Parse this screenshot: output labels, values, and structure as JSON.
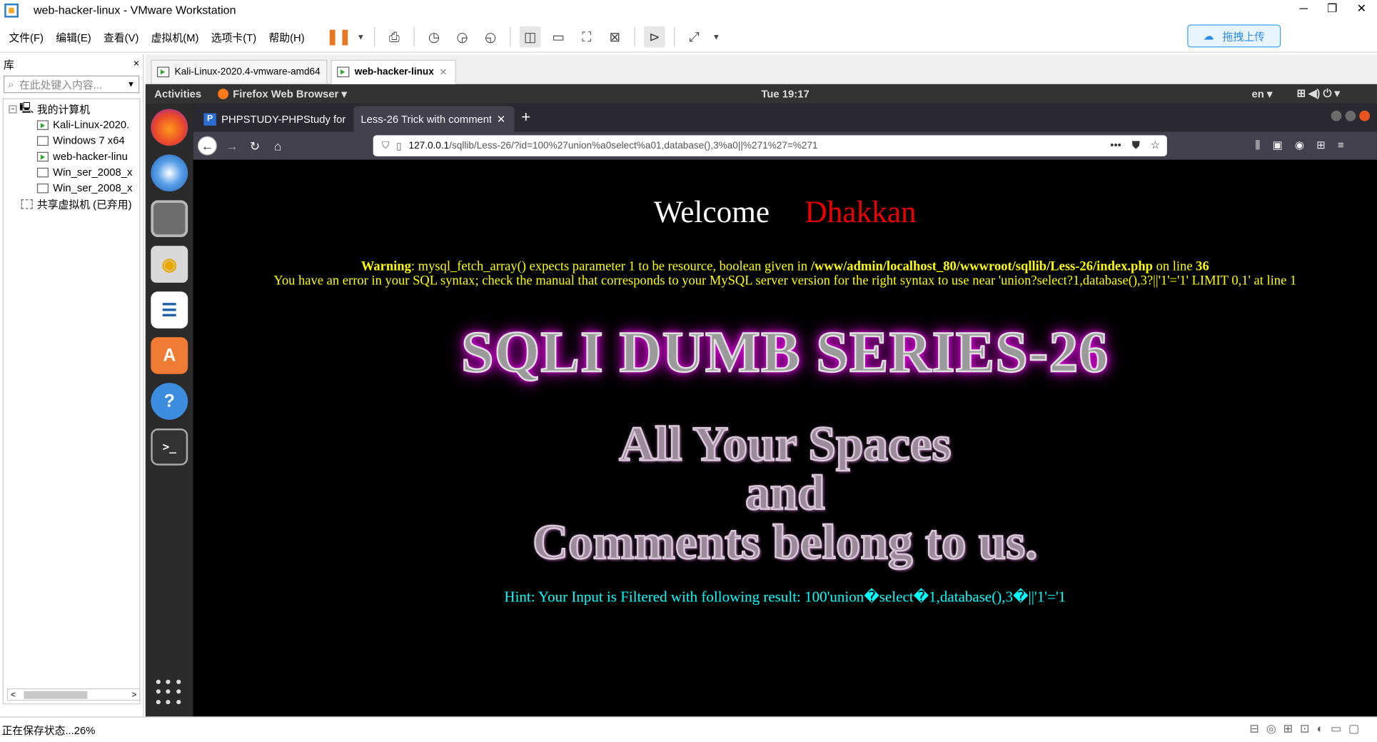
{
  "window": {
    "title": "web-hacker-linux - VMware Workstation",
    "controls": [
      "─",
      "❐",
      "✕"
    ]
  },
  "menubar": {
    "items": [
      "文件(F)",
      "编辑(E)",
      "查看(V)",
      "虚拟机(M)",
      "选项卡(T)",
      "帮助(H)"
    ]
  },
  "upload_button": "拖拽上传",
  "library": {
    "title": "库",
    "close": "×",
    "search_placeholder": "在此处键入内容...",
    "tree": {
      "root": "我的计算机",
      "vms": [
        "Kali-Linux-2020.",
        "Windows 7 x64",
        "web-hacker-linu",
        "Win_ser_2008_x",
        "Win_ser_2008_x"
      ],
      "shared": "共享虚拟机 (已弃用)"
    }
  },
  "vm_tabs": [
    "Kali-Linux-2020.4-vmware-amd64",
    "web-hacker-linux"
  ],
  "guest": {
    "activities": "Activities",
    "app_menu": "Firefox Web Browser ▾",
    "clock": "Tue 19:17",
    "lang": "en ▾",
    "sys_icons": "⊞  ◀)  ⏻ ▾"
  },
  "firefox": {
    "tabs": [
      "PHPSTUDY-PHPStudy for",
      "Less-26 Trick with comment"
    ],
    "url_host": "127.0.0.1",
    "url_path": "/sqllib/Less-26/?id=100%27union%a0select%a01,database(),3%a0||%271%27=%271"
  },
  "page": {
    "welcome": "Welcome",
    "name": "Dhakkan",
    "warning_label": "Warning",
    "warning_text": ": mysql_fetch_array() expects parameter 1 to be resource, boolean given in ",
    "warning_path": "/www/admin/localhost_80/wwwroot/sqllib/Less-26/index.php",
    "warning_online": " on line ",
    "warning_line": "36",
    "sql_error": "You have an error in your SQL syntax; check the manual that corresponds to your MySQL server version for the right syntax to use near 'union?select?1,database(),3?||'1'='1' LIMIT 0,1' at line 1",
    "series_title": "SQLI DUMB SERIES-26",
    "slogan_1": "All Your Spaces",
    "slogan_2": "and",
    "slogan_3": "Comments belong to us.",
    "hint": "Hint: Your Input is Filtered with following result: 100'union�select�1,database(),3�||'1'='1"
  },
  "status_bar": {
    "text": "正在保存状态...26%"
  },
  "colors": {
    "welcome": "#ffffff",
    "name": "#ee0000",
    "warning": "#ffff00",
    "hint": "#00ffff",
    "series_glow": "#ff00ff"
  }
}
